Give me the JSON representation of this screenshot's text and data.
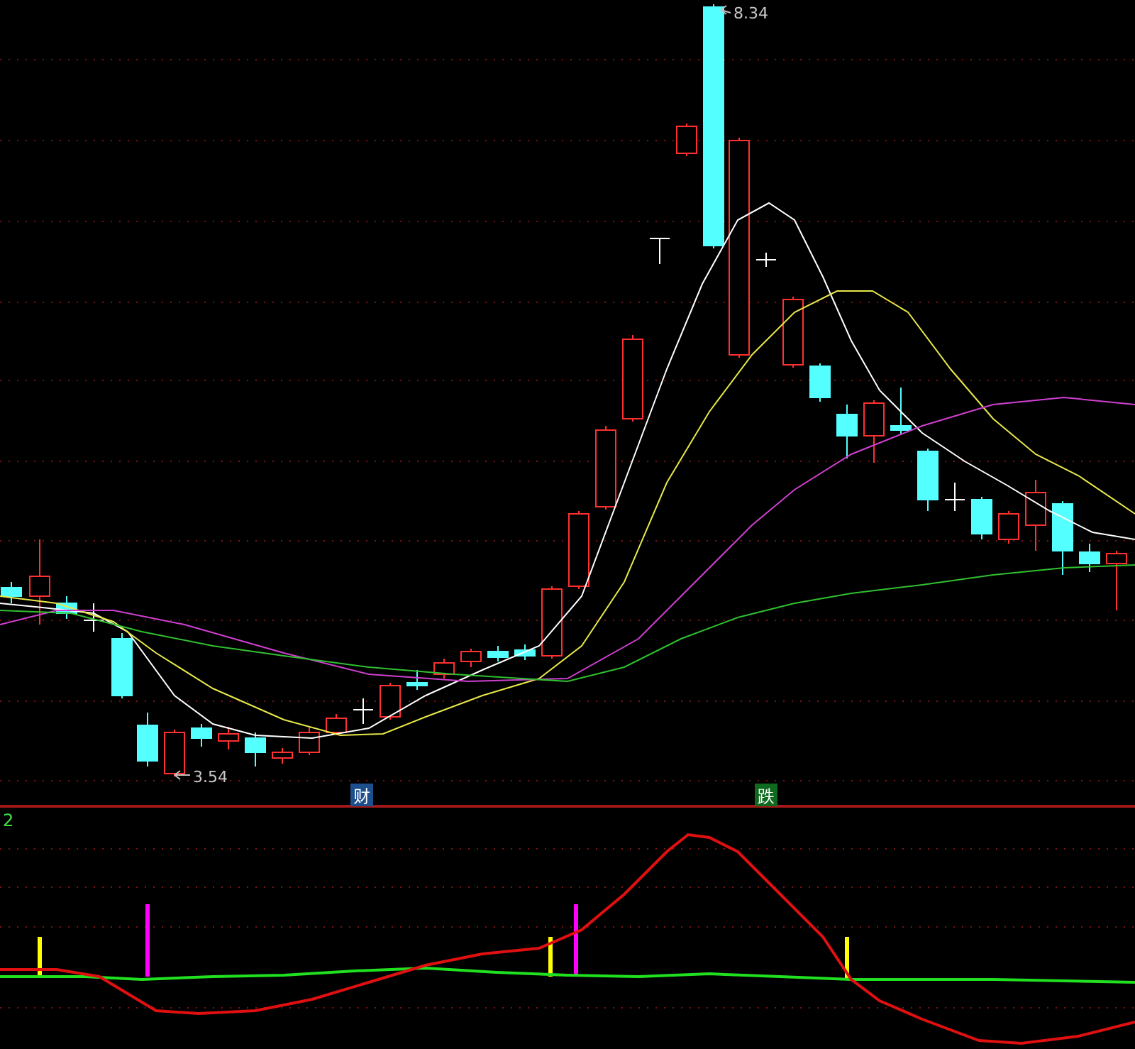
{
  "main_chart": {
    "high_label": "8.34",
    "low_label": "3.54",
    "markers": [
      {
        "text": "财",
        "color": "#1d4f8c"
      },
      {
        "text": "跌",
        "color": "#0f6a1f"
      }
    ]
  },
  "indicator_panel": {
    "label": "2"
  }
}
